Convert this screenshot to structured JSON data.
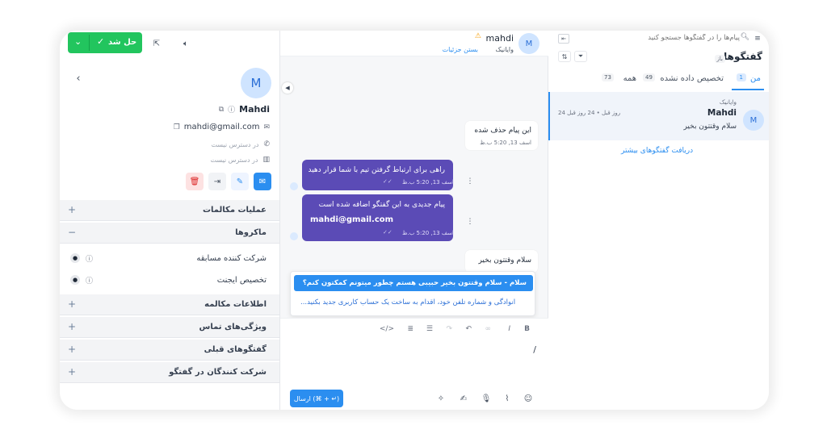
{
  "header": {
    "contact_name": "mahdi",
    "channel": "وایانیک",
    "close_details": "بستن جزئیات",
    "avatar_letter": "M",
    "resolve_label": "حل شد"
  },
  "contact": {
    "avatar_letter": "M",
    "name": "Mahdi",
    "email": "mahdi@gmail.com",
    "phone": "در دسترس نیست",
    "company": "در دسترس نیست"
  },
  "accordions": {
    "conversation_actions": "عملیات مکالمات",
    "macros": "ماکروها",
    "macro_items": [
      "شرکت کننده مسابقه",
      "تخصیص ایجنت"
    ],
    "conversation_info": "اطلاعات مکالمه",
    "contact_attributes": "ویژگی‌های تماس",
    "previous_conversations": "گفتگوهای قبلی",
    "participants": "شرکت کنندگان در گفتگو"
  },
  "messages": [
    {
      "text": "این پیام حذف شده",
      "time": "اسف 13, 5:20 ب.ظ"
    },
    {
      "text": "راهی برای ارتباط گرفتن تیم با شما قرار دهید",
      "time": "اسف 13, 5:20 ب.ظ"
    },
    {
      "text": "پیام جدیدی به این گفتگو اضافه شده است",
      "email": "mahdi@gmail.com",
      "time": "اسف 13, 5:20 ب.ظ"
    },
    {
      "text": "سلام وقتتون بخیر"
    }
  ],
  "canned": {
    "item1": "سلام - سلام وقتتون بخیر حبیبی هستم چطور میتونم کمکتون کنم؟",
    "item2": "...انوادگی و شماره تلفن خود، اقدام به ساخت یک حساب کاربری جدید بکنید"
  },
  "composer": {
    "input_value": "/",
    "send_label": "ارسال (⌘ + ↵)"
  },
  "list": {
    "search_placeholder": "پیام‌ها را در گفتگوها جستجو کنید",
    "title": "گفتگوها",
    "status": "باز",
    "tabs": [
      {
        "label": "من",
        "count": "1"
      },
      {
        "label": "تخصیص داده نشده",
        "count": "49"
      },
      {
        "label": "همه",
        "count": "73"
      }
    ],
    "item": {
      "channel": "وایانیک",
      "name": "Mahdi",
      "preview": "سلام وقتتون بخیر",
      "time": "24 روز قبل • 24 روز قبل",
      "avatar_letter": "M"
    },
    "load_more": "دریافت گفتگوهای بیشتر"
  },
  "colors": {
    "accent": "#2b8ef0",
    "resolve": "#22c55e",
    "outgoing": "#5b4bb6"
  }
}
